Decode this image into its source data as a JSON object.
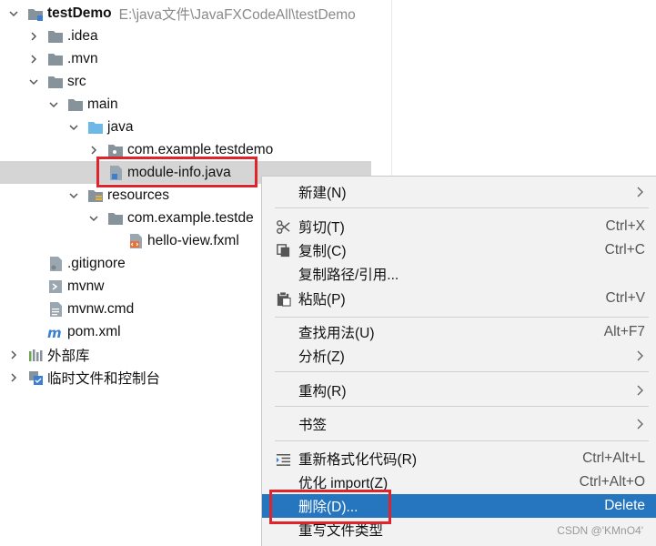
{
  "tree": {
    "root": {
      "label": "testDemo",
      "path": "E:\\java文件\\JavaFXCodeAll\\testDemo"
    },
    "items": [
      {
        "label": ".idea"
      },
      {
        "label": ".mvn"
      },
      {
        "label": "src"
      },
      {
        "label": "main"
      },
      {
        "label": "java"
      },
      {
        "label": "com.example.testdemo"
      },
      {
        "label": "module-info.java"
      },
      {
        "label": "resources"
      },
      {
        "label": "com.example.testde"
      },
      {
        "label": "hello-view.fxml"
      },
      {
        "label": ".gitignore"
      },
      {
        "label": "mvnw"
      },
      {
        "label": "mvnw.cmd"
      },
      {
        "label": "pom.xml"
      },
      {
        "label": "外部库"
      },
      {
        "label": "临时文件和控制台"
      }
    ]
  },
  "context_menu": {
    "items": [
      {
        "label": "新建(N)",
        "shortcut": "",
        "submenu": true
      },
      {
        "label": "剪切(T)",
        "shortcut": "Ctrl+X"
      },
      {
        "label": "复制(C)",
        "shortcut": "Ctrl+C"
      },
      {
        "label": "复制路径/引用...",
        "shortcut": ""
      },
      {
        "label": "粘贴(P)",
        "shortcut": "Ctrl+V"
      },
      {
        "label": "查找用法(U)",
        "shortcut": "Alt+F7"
      },
      {
        "label": "分析(Z)",
        "shortcut": "",
        "submenu": true
      },
      {
        "label": "重构(R)",
        "shortcut": "",
        "submenu": true
      },
      {
        "label": "书签",
        "shortcut": "",
        "submenu": true
      },
      {
        "label": "重新格式化代码(R)",
        "shortcut": "Ctrl+Alt+L"
      },
      {
        "label": "优化 import(Z)",
        "shortcut": "Ctrl+Alt+O"
      },
      {
        "label": "删除(D)...",
        "shortcut": "Delete",
        "active": true
      },
      {
        "label": "重写文件类型",
        "shortcut": ""
      }
    ]
  },
  "watermark": "CSDN @'KMnO4'",
  "colors": {
    "selection": "#2675bf",
    "highlight_box": "#e0242c",
    "folder": "#87939a",
    "source_folder": "#6eb8e8"
  }
}
